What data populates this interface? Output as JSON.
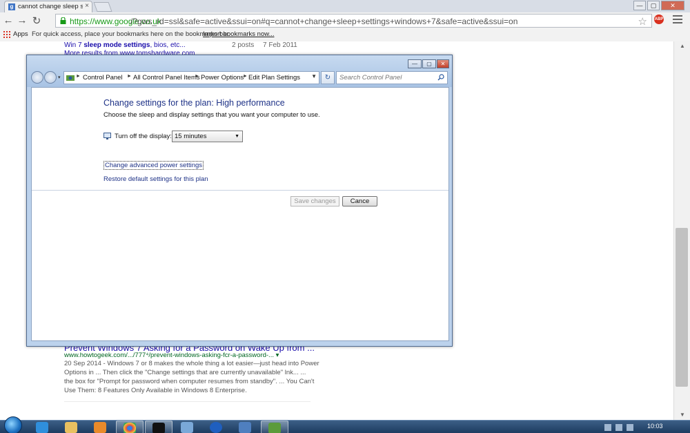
{
  "browser": {
    "tab_title": "cannot change sleep setti",
    "tab_favicon": "g",
    "tab_close": "×",
    "url_green": "https://www.google.co.uk",
    "url_rest": "/?gws_rd=ssl&safe=active&ssui=on#q=cannot+change+sleep+settings+windows+7&safe=active&ssui=on",
    "abp_label": "ABP",
    "bookmarks": {
      "apps_label": "Apps",
      "hint": "For quick access, place your bookmarks here on the bookmarks bar.",
      "import_link": "Import bookmarks now..."
    },
    "window_controls": {
      "minimize": "—",
      "restore": "▢",
      "close": "✕"
    }
  },
  "page": {
    "result1": {
      "title_part1": "Win 7 ",
      "title_bold": "sleep mode settings",
      "title_part2": ", bios, etc...",
      "posts": "2 posts",
      "date": "7 Feb 2011",
      "more": "More results from www.tomshardware.com"
    },
    "result2": {
      "title": "Prevent Windows 7 Asking for a Password on Wake Up from ...",
      "url": "www.howtogeek.com/.../777⁴/prevent-windows-asking-fcr-a-password-...",
      "url_arrow": "▾",
      "snippet": [
        "20 Sep 2014 - Windows 7 or 8 makes the whole thing a lot easier—just head into Power",
        "Options in ... Then click the \"Change settings that are currently unavailable\" lnk... ...",
        "the box for \"Prompt for password when computer resumes from standby\". ... You Can't",
        "Use Them: 8 Features Only Available in Windows 8 Enterprise."
      ]
    }
  },
  "control_panel": {
    "breadcrumbs": [
      "Control Panel",
      "All Control Panel Items",
      "Power Options",
      "Edit Plan Settings"
    ],
    "search_placeholder": "Search Control Panel",
    "title": "Change settings for the plan: High performance",
    "description": "Choose the sleep and display settings that you want your computer to use.",
    "display_label": "Turn off the display:",
    "display_value": "15 minutes",
    "link_advanced": "Change advanced power settings",
    "link_restore": "Restore default settings for this plan",
    "save_button": "Save changes",
    "cancel_button": "Cance",
    "window_controls": {
      "minimize": "—",
      "maximize": "▢",
      "close": "✕"
    }
  },
  "taskbar": {
    "time": "10:03",
    "items": [
      "internet-explorer",
      "file-explorer",
      "media-player",
      "chrome",
      "command-prompt",
      "paint",
      "info",
      "remote-desktop",
      "control-panel"
    ]
  },
  "colors": {
    "link_blue": "#1a0dab",
    "url_green": "#189a18",
    "cp_title_blue": "#1e3287",
    "taskbar": "#1d3c61"
  }
}
